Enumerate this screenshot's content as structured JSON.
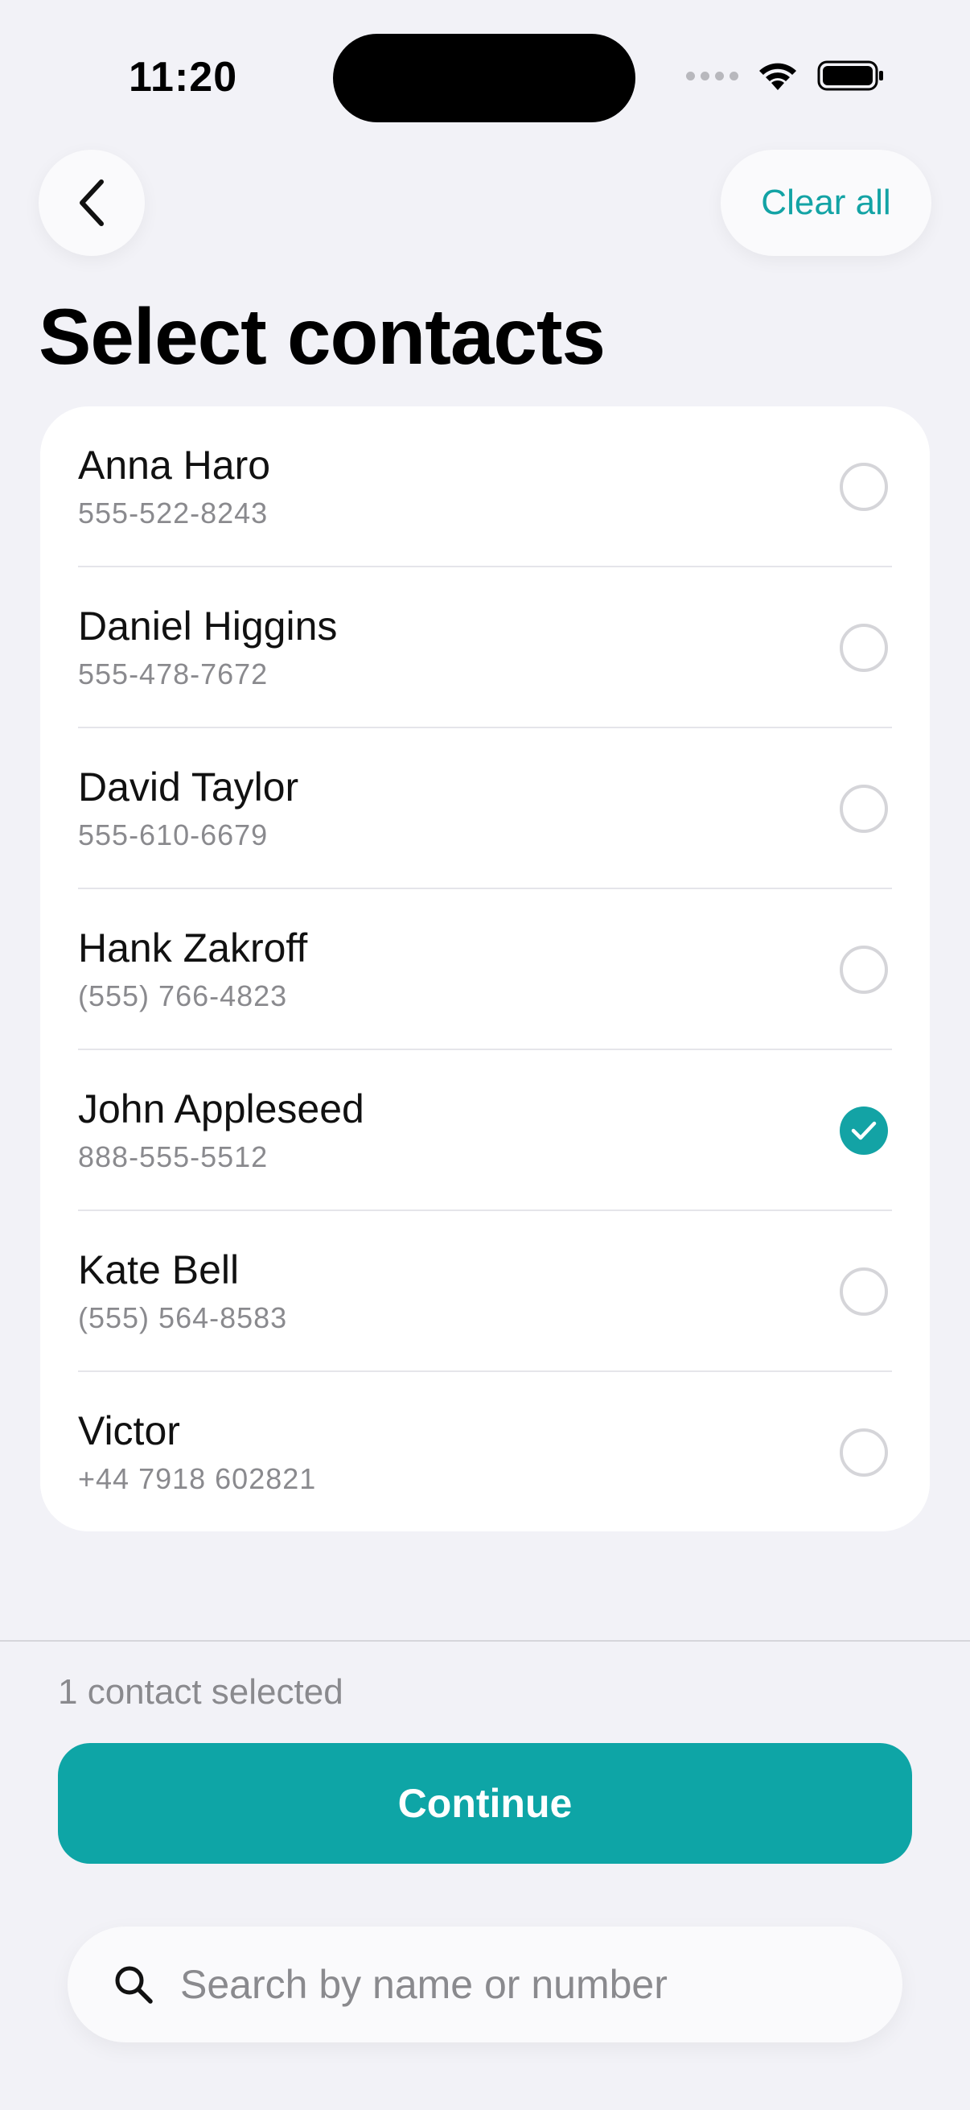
{
  "status_bar": {
    "time": "11:20"
  },
  "header": {
    "back_icon": "chevron-left-icon",
    "clear_label": "Clear all",
    "title": "Select contacts"
  },
  "contacts": [
    {
      "name": "Anna Haro",
      "phone": "555-522-8243",
      "selected": false
    },
    {
      "name": "Daniel Higgins",
      "phone": "555-478-7672",
      "selected": false
    },
    {
      "name": "David Taylor",
      "phone": "555-610-6679",
      "selected": false
    },
    {
      "name": "Hank Zakroff",
      "phone": "(555) 766-4823",
      "selected": false
    },
    {
      "name": "John Appleseed",
      "phone": "888-555-5512",
      "selected": true
    },
    {
      "name": "Kate Bell",
      "phone": "(555) 564-8583",
      "selected": false
    },
    {
      "name": "Victor",
      "phone": "+44 7918 602821",
      "selected": false
    }
  ],
  "footer": {
    "selected_text": "1 contact selected",
    "continue_label": "Continue"
  },
  "search": {
    "placeholder": "Search by name or number",
    "value": ""
  },
  "colors": {
    "accent": "#0ea5a6",
    "background": "#f2f2f7",
    "secondary_text": "#8a8a8e"
  }
}
